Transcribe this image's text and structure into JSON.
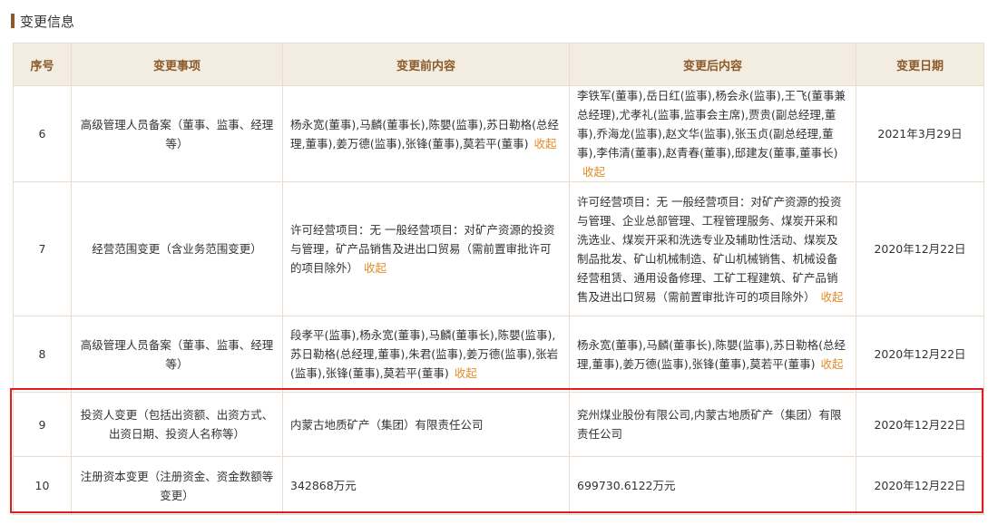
{
  "section": {
    "title": "变更信息"
  },
  "table": {
    "headers": {
      "seq": "序号",
      "item": "变更事项",
      "before": "变更前内容",
      "after": "变更后内容",
      "date": "变更日期"
    },
    "collapse_label": "收起",
    "rows": [
      {
        "seq": "6",
        "item": "高级管理人员备案（董事、监事、经理等）",
        "before": "杨永宽(董事),马麟(董事长),陈嬰(监事),苏日勒格(总经理,董事),姜万德(监事),张锋(董事),莫若平(董事)",
        "after": "李铁军(董事),岳日红(监事),杨会永(监事),王飞(董事兼总经理),尤孝礼(监事,监事会主席),贾贵(副总经理,董事),乔海龙(监事),赵文华(监事),张玉贞(副总经理,董事),李伟清(董事),赵青春(董事),邸建友(董事,董事长)",
        "date": "2021年3月29日"
      },
      {
        "seq": "7",
        "item": "经营范围变更（含业务范围变更）",
        "before": "许可经营项目：无 一般经营项目：对矿产资源的投资与管理，矿产品销售及进出口贸易（需前置审批许可的项目除外）",
        "after": "许可经营项目：无 一般经营项目：对矿产资源的投资与管理、企业总部管理、工程管理服务、煤炭开采和洗选业、煤炭开采和洗选专业及辅助性活动、煤炭及制品批发、矿山机械制造、矿山机械销售、机械设备经营租赁、通用设备修理、工矿工程建筑、矿产品销售及进出口贸易（需前置审批许可的项目除外）",
        "date": "2020年12月22日"
      },
      {
        "seq": "8",
        "item": "高级管理人员备案（董事、监事、经理等）",
        "before": "段孝平(监事),杨永宽(董事),马麟(董事长),陈嬰(监事),苏日勒格(总经理,董事),朱君(监事),姜万德(监事),张岩(监事),张锋(董事),莫若平(董事)",
        "after": "杨永宽(董事),马麟(董事长),陈嬰(监事),苏日勒格(总经理,董事),姜万德(监事),张锋(董事),莫若平(董事)",
        "date": "2020年12月22日"
      },
      {
        "seq": "9",
        "item": "投资人变更（包括出资额、出资方式、出资日期、投资人名称等）",
        "before": "内蒙古地质矿产（集团）有限责任公司",
        "after": "兖州煤业股份有限公司,内蒙古地质矿产（集团）有限责任公司",
        "date": "2020年12月22日"
      },
      {
        "seq": "10",
        "item": "注册资本变更（注册资金、资金数额等变更）",
        "before": "342868万元",
        "after": "699730.6122万元",
        "date": "2020年12月22日"
      }
    ]
  },
  "colors": {
    "header_bg": "#f3ece0",
    "header_text": "#8a5a2b",
    "link": "#e58c2a",
    "highlight": "#e02020",
    "border": "#e8dccc"
  }
}
